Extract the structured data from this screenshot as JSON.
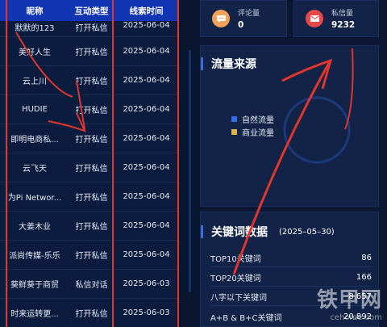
{
  "table": {
    "headers": [
      "昵称",
      "互动类型",
      "线索时间"
    ],
    "rows": [
      {
        "name": "默默的123",
        "type": "打开私信",
        "time": "2025-06-04"
      },
      {
        "name": "美好人生",
        "type": "打开私信",
        "time": "2025-06-04"
      },
      {
        "name": "云上川",
        "type": "打开私信",
        "time": "2025-06-04"
      },
      {
        "name": "HUDIE",
        "type": "打开私信",
        "time": "2025-06-04"
      },
      {
        "name": "即明电商私...",
        "type": "打开私信",
        "time": "2025-06-04"
      },
      {
        "name": "云飞天",
        "type": "打开私信",
        "time": "2025-06-04"
      },
      {
        "name": "为Pi Networ...",
        "type": "打开私信",
        "time": "2025-06-04"
      },
      {
        "name": "大姜木业",
        "type": "打开私信",
        "time": "2025-06-04"
      },
      {
        "name": "派尚传媒-乐乐",
        "type": "打开私信",
        "time": "2025-06-04"
      },
      {
        "name": "葵鲜葵于商贸",
        "type": "私信对话",
        "time": "2025-06-03"
      },
      {
        "name": "时来运转更...",
        "type": "打开私信",
        "time": "2025-06-03"
      }
    ]
  },
  "stats": {
    "comments": {
      "label": "评论量",
      "value": "0",
      "icon": "comment-icon",
      "color": "#f3a25b"
    },
    "messages": {
      "label": "私信量",
      "value": "9232",
      "icon": "mail-icon",
      "color": "#e8484a"
    }
  },
  "traffic": {
    "title": "流量来源",
    "legend": [
      {
        "label": "自然流量",
        "color": "#2f6df6"
      },
      {
        "label": "商业流量",
        "color": "#e2b53a"
      }
    ]
  },
  "keywords": {
    "title": "关键词数据",
    "date": "(2025–05–30)",
    "rows": [
      {
        "label": "TOP10关键词",
        "value": "86"
      },
      {
        "label": "TOP20关键词",
        "value": "166"
      },
      {
        "label": "八字以下关键词",
        "value": "8,657"
      },
      {
        "label": "A+B & B+C关键词",
        "value": "20,892"
      }
    ]
  },
  "watermark": {
    "main": "铁甲网",
    "sub": "cehome.com"
  }
}
